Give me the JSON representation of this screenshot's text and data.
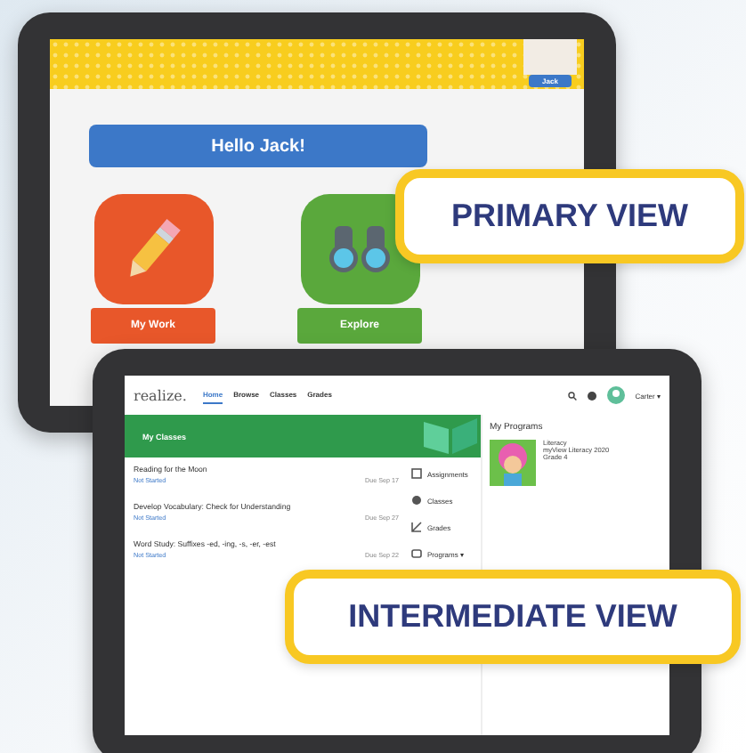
{
  "primary": {
    "user_name": "Jack",
    "greeting": "Hello Jack!",
    "tiles": [
      {
        "label": "My Work",
        "kind": "pencil",
        "color": "#e8572a"
      },
      {
        "label": "Explore",
        "kind": "binoculars",
        "color": "#5aa83c"
      }
    ]
  },
  "primary_callout": "PRIMARY VIEW",
  "intermediate": {
    "logo": "realize.",
    "nav": [
      {
        "label": "Home",
        "selected": true
      },
      {
        "label": "Browse",
        "selected": false
      },
      {
        "label": "Classes",
        "selected": false
      },
      {
        "label": "Grades",
        "selected": false
      }
    ],
    "user": "Carter",
    "user_caret": "▾",
    "banner": "My Classes",
    "assignments": [
      {
        "title": "Reading for the Moon",
        "status": "Not Started",
        "due": "Due Sep 17"
      },
      {
        "title": "Develop Vocabulary: Check for Understanding",
        "status": "Not Started",
        "due": "Due Sep 27"
      },
      {
        "title": "Word Study: Suffixes -ed, -ing, -s, -er, -est",
        "status": "Not Started",
        "due": "Due Sep 22"
      }
    ],
    "menu": [
      {
        "label": "Assignments",
        "kind": "assignments"
      },
      {
        "label": "Classes",
        "kind": "classes"
      },
      {
        "label": "Grades",
        "kind": "grades"
      },
      {
        "label": "Programs",
        "kind": "programs",
        "caret": "▾"
      }
    ],
    "programs_heading": "My Programs",
    "program": {
      "subject": "Literacy",
      "title": "myView Literacy 2020",
      "grade": "Grade 4"
    }
  },
  "intermediate_callout": "INTERMEDIATE VIEW"
}
